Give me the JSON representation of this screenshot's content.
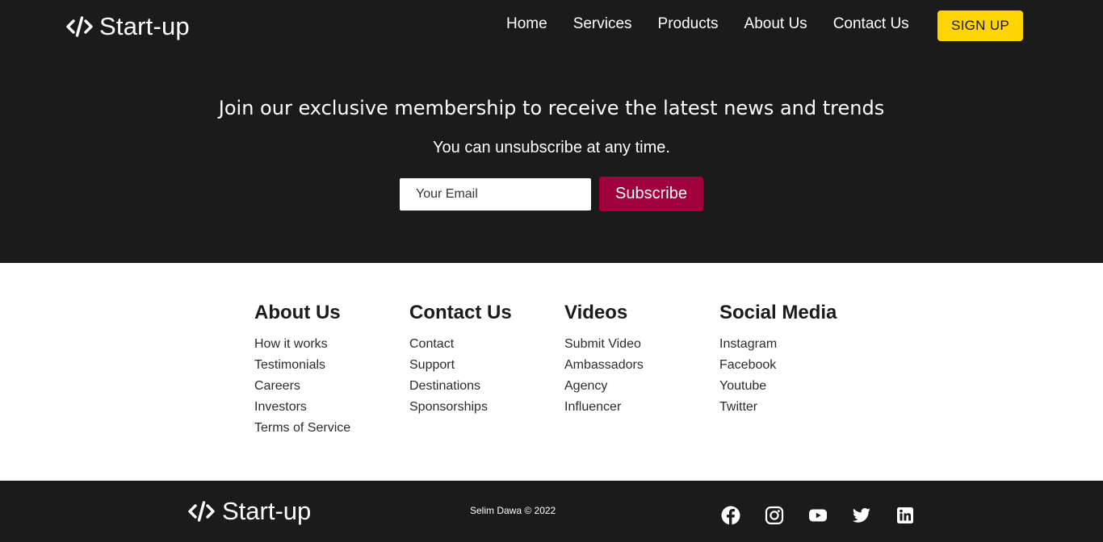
{
  "brand": {
    "name": "Start-up",
    "icon": "code-icon"
  },
  "nav": {
    "links": [
      "Home",
      "Services",
      "Products",
      "About Us",
      "Contact Us"
    ],
    "signup_label": "SIGN UP"
  },
  "hero": {
    "heading": "Join our exclusive membership to receive the latest news and trends",
    "subheading": "You can unsubscribe at any time.",
    "email_placeholder": "Your Email",
    "subscribe_label": "Subscribe"
  },
  "link_columns": [
    {
      "title": "About Us",
      "items": [
        "How it works",
        "Testimonials",
        "Careers",
        "Investors",
        "Terms of Service"
      ]
    },
    {
      "title": "Contact Us",
      "items": [
        "Contact",
        "Support",
        "Destinations",
        "Sponsorships"
      ]
    },
    {
      "title": "Videos",
      "items": [
        "Submit Video",
        "Ambassadors",
        "Agency",
        "Influencer"
      ]
    },
    {
      "title": "Social Media",
      "items": [
        "Instagram",
        "Facebook",
        "Youtube",
        "Twitter"
      ]
    }
  ],
  "footer": {
    "copyright": "Selim Dawa © 2022",
    "social_icons": [
      "facebook-icon",
      "instagram-icon",
      "youtube-icon",
      "twitter-icon",
      "linkedin-icon"
    ]
  },
  "colors": {
    "dark_bg": "#1b1b1b",
    "signup_accent": "#ffd400",
    "subscribe_accent": "#a0003c",
    "light_bg": "#ffffff"
  }
}
